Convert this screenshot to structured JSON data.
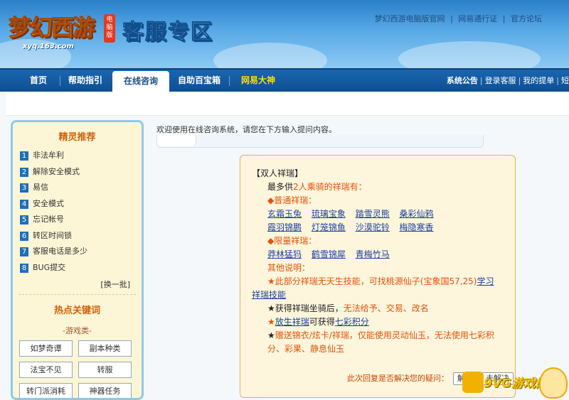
{
  "header": {
    "logo_text": "梦幻西游",
    "logo_badge": "电脑版",
    "logo_url": "xyq.163.com",
    "site_title": "客服专区",
    "top_links": [
      "梦幻西游电脑版官网",
      "网易通行证",
      "官方论坛"
    ]
  },
  "nav": {
    "tabs": [
      "首页",
      "帮助指引",
      "在线咨询",
      "自助百宝箱",
      "网易大神"
    ],
    "active": "在线咨询",
    "right_links": [
      "系统公告",
      "登录客服",
      "我的提单",
      "短"
    ]
  },
  "sidebar": {
    "title": "精灵推荐",
    "items": [
      {
        "num": "1",
        "label": "非法牟利"
      },
      {
        "num": "2",
        "label": "解除安全模式"
      },
      {
        "num": "3",
        "label": "易信"
      },
      {
        "num": "4",
        "label": "安全模式"
      },
      {
        "num": "5",
        "label": "忘记帐号"
      },
      {
        "num": "6",
        "label": "转区时间锁"
      },
      {
        "num": "7",
        "label": "客服电话是多少"
      },
      {
        "num": "8",
        "label": "BUG提交"
      }
    ],
    "batch": "[换一批]",
    "hot_title": "热点关键词",
    "category": "-游戏类-",
    "keywords": [
      "如梦奇谭",
      "副本种类",
      "法宝不见",
      "转服",
      "转门派消耗",
      "神器任务"
    ]
  },
  "main": {
    "welcome": "欢迎使用在线咨询系统，请您在下方输入提问内容。",
    "answer": {
      "heading": "【双人祥瑞】",
      "max_prefix": "最多供",
      "max_highlight": "2人乘骑的祥瑞有：",
      "normal_label": "◆普通祥瑞：",
      "normal_row1": [
        "玄霜玉兔",
        "琉璃宝象",
        "踏雪灵熊",
        "桑彩仙鸦"
      ],
      "normal_row2": [
        "霞羽锦鹏",
        "灯笼锦鱼",
        "沙漠驼铃",
        "梅隐寒香"
      ],
      "limited_label": "◆限量祥瑞：",
      "limited_row": [
        "莽林猛犸",
        "鹤雪锦犀",
        "青梅竹马"
      ],
      "other_label": "其他说明：",
      "note1_star": "★",
      "note1_text": "此部分祥瑞无天生技能，可找桃源仙子(宝象国57,25)",
      "note1_link_a": "学习",
      "note1_link_b": "祥瑞技能",
      "note2_star": "★",
      "note2_text": "获得祥瑞坐骑后，",
      "note2_orange": "无法给予、交易、改名",
      "note3_star": "★",
      "note3_link": "放生祥瑞",
      "note3_mid": "可获得",
      "note3_link2": "七彩积分",
      "note4_star": "★",
      "note4_text": "赠送锦衣/炫卡/祥瑞，仅能使用灵动仙玉，无法使用七彩积分、彩果、静息仙玉",
      "feedback": "此次回复是否解决您的疑问：",
      "btn_yes": "解决",
      "btn_no": "未解决"
    }
  },
  "watermark": "9VG游戏网"
}
